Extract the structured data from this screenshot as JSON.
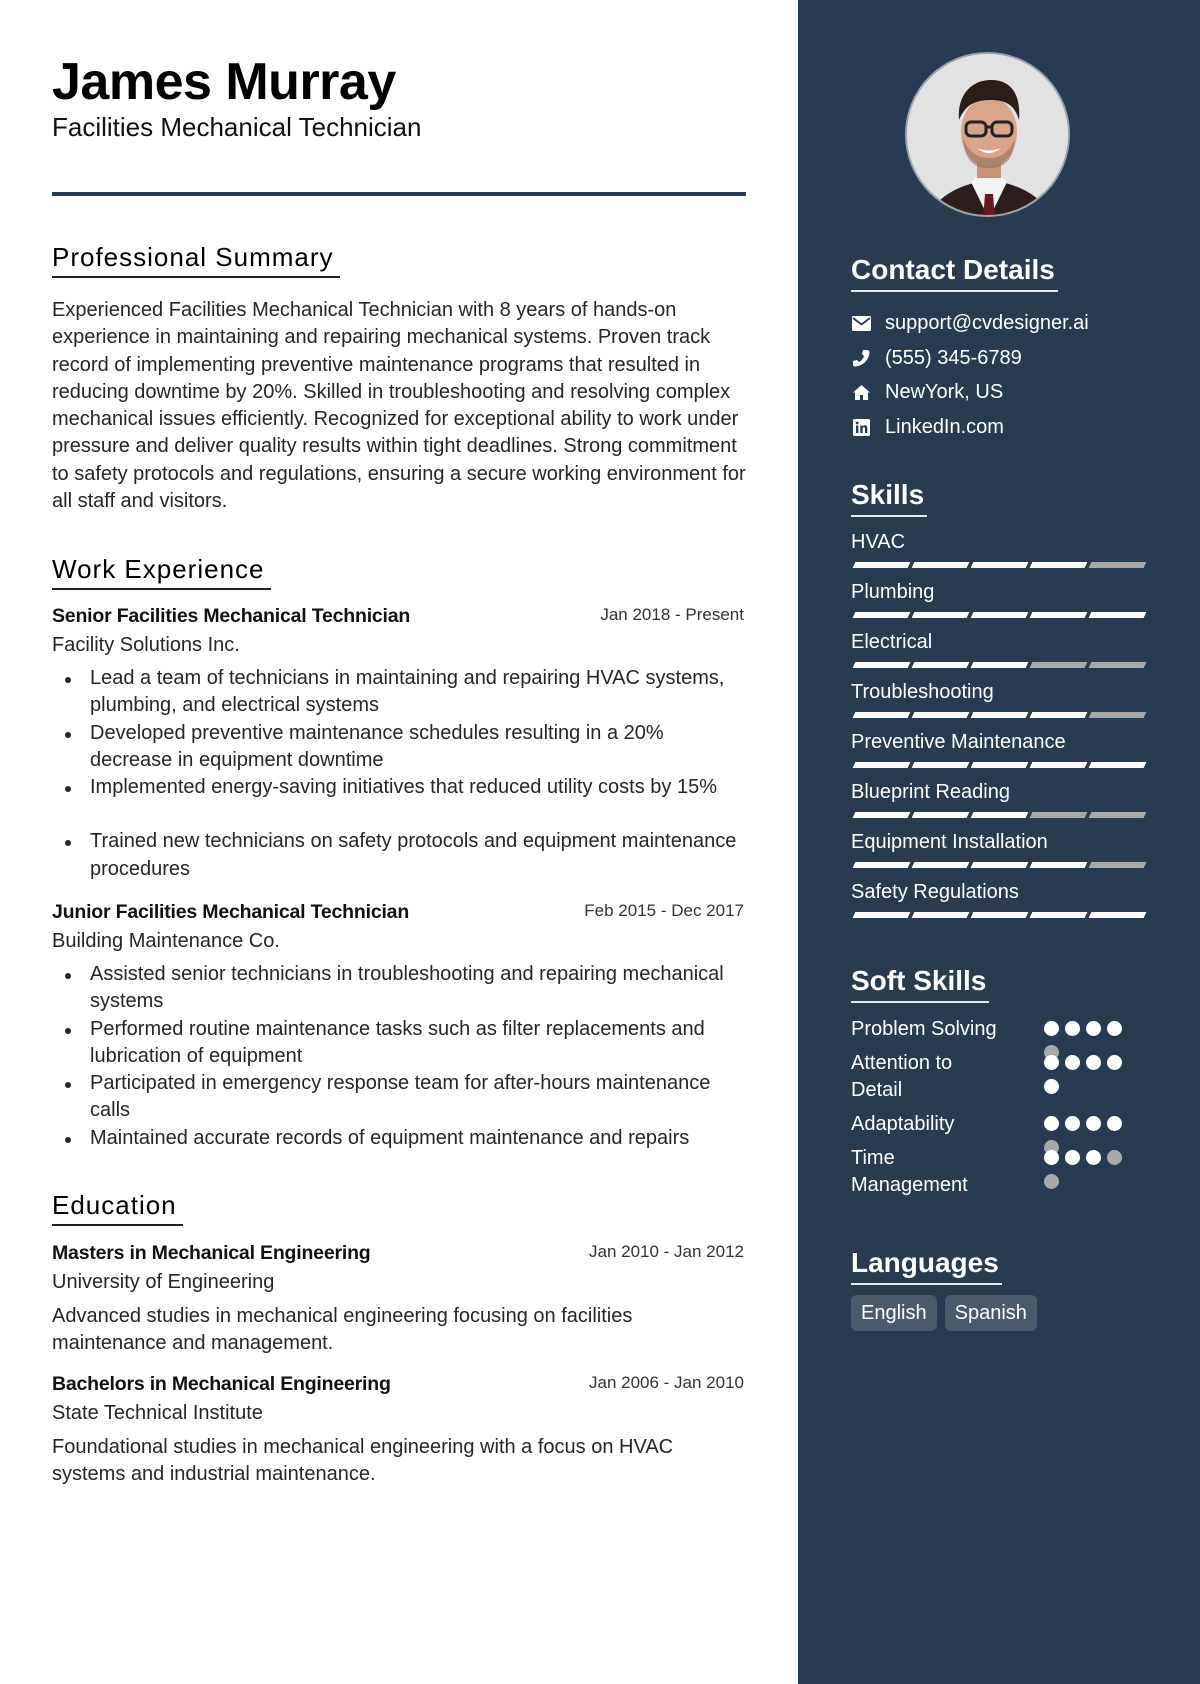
{
  "header": {
    "name": "James Murray",
    "title": "Facilities Mechanical Technician"
  },
  "colors": {
    "sidebar_bg": "#283b50",
    "accent_divider": "#283b50",
    "skill_on": "#ffffff",
    "skill_off": "#a9a9a9",
    "language_chip": "#4a5a6b"
  },
  "summary": {
    "heading": "Professional Summary",
    "text": "Experienced Facilities Mechanical Technician with 8 years of hands-on experience in maintaining and repairing mechanical systems. Proven track record of implementing preventive maintenance programs that resulted in reducing downtime by 20%. Skilled in troubleshooting and resolving complex mechanical issues efficiently. Recognized for exceptional ability to work under pressure and deliver quality results within tight deadlines. Strong commitment to safety protocols and regulations, ensuring a secure working environment for all staff and visitors."
  },
  "experience": {
    "heading": "Work Experience",
    "jobs": [
      {
        "title": "Senior Facilities Mechanical Technician",
        "dates": "Jan 2018 - Present",
        "company": "Facility Solutions Inc.",
        "bullets": [
          "Lead a team of technicians in maintaining and repairing HVAC systems, plumbing, and electrical systems",
          "Developed preventive maintenance schedules resulting in a 20% decrease in equipment downtime",
          "Implemented energy-saving initiatives that reduced utility costs by 15%",
          "Trained new technicians on safety protocols and equipment maintenance procedures"
        ]
      },
      {
        "title": "Junior Facilities Mechanical Technician",
        "dates": "Feb 2015 - Dec 2017",
        "company": "Building Maintenance Co.",
        "bullets": [
          "Assisted senior technicians in troubleshooting and repairing mechanical systems",
          "Performed routine maintenance tasks such as filter replacements and lubrication of equipment",
          "Participated in emergency response team for after-hours maintenance calls",
          "Maintained accurate records of equipment maintenance and repairs"
        ]
      }
    ]
  },
  "education": {
    "heading": "Education",
    "items": [
      {
        "degree": "Masters in Mechanical Engineering",
        "dates": "Jan 2010 - Jan 2012",
        "school": "University of Engineering",
        "description": "Advanced studies in mechanical engineering focusing on facilities maintenance and management."
      },
      {
        "degree": "Bachelors in Mechanical Engineering",
        "dates": "Jan 2006 - Jan 2010",
        "school": "State Technical Institute",
        "description": "Foundational studies in mechanical engineering with a focus on HVAC systems and industrial maintenance."
      }
    ]
  },
  "sidebar": {
    "photo_alt": "Profile photo of James Murray",
    "contact": {
      "heading": "Contact Details",
      "items": [
        {
          "icon": "envelope-icon",
          "text": "support@cvdesigner.ai"
        },
        {
          "icon": "phone-icon",
          "text": "(555) 345-6789"
        },
        {
          "icon": "home-icon",
          "text": "NewYork, US"
        },
        {
          "icon": "linkedin-icon",
          "text": "LinkedIn.com"
        }
      ]
    },
    "skills": {
      "heading": "Skills",
      "max": 5,
      "items": [
        {
          "name": "HVAC",
          "level": 4
        },
        {
          "name": "Plumbing",
          "level": 5
        },
        {
          "name": "Electrical",
          "level": 3
        },
        {
          "name": "Troubleshooting",
          "level": 4
        },
        {
          "name": "Preventive Maintenance",
          "level": 5
        },
        {
          "name": "Blueprint Reading",
          "level": 3
        },
        {
          "name": "Equipment Installation",
          "level": 4
        },
        {
          "name": "Safety Regulations",
          "level": 5
        }
      ]
    },
    "soft_skills": {
      "heading": "Soft Skills",
      "max": 5,
      "items": [
        {
          "name": "Problem Solving",
          "level": 4
        },
        {
          "name": "Attention to Detail",
          "level": 5
        },
        {
          "name": "Adaptability",
          "level": 4
        },
        {
          "name": "Time Management",
          "level": 3
        }
      ]
    },
    "languages": {
      "heading": "Languages",
      "items": [
        "English",
        "Spanish"
      ]
    }
  }
}
